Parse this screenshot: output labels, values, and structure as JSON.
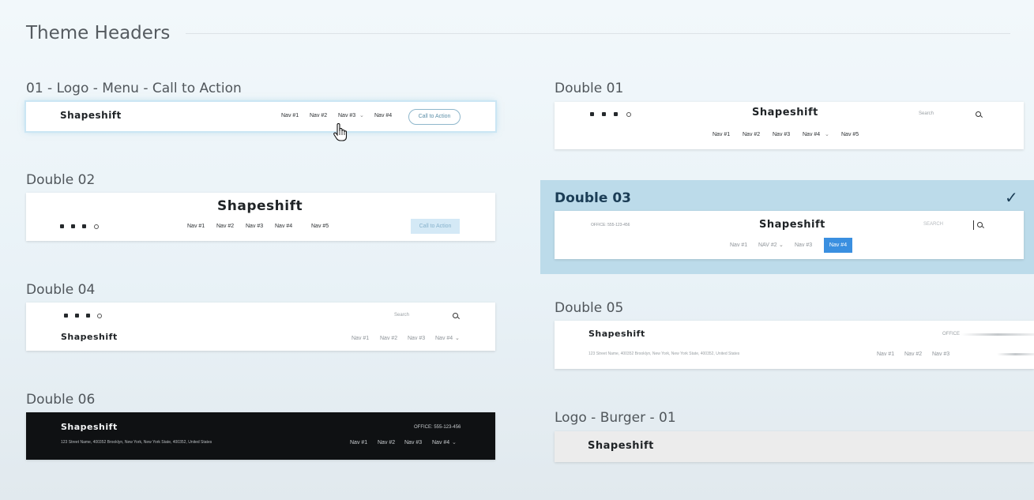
{
  "page": {
    "title": "Theme Headers"
  },
  "tiles": {
    "t01": {
      "title": "01 - Logo - Menu - Call to Action",
      "logo": "Shapeshift",
      "nav": [
        "Nav #1",
        "Nav #2",
        "Nav #3",
        "Nav #4"
      ],
      "cta": "Call to Action"
    },
    "d01": {
      "title": "Double 01",
      "logo": "Shapeshift",
      "search": "Search",
      "nav": [
        "Nav #1",
        "Nav #2",
        "Nav #3",
        "Nav #4",
        "Nav #5"
      ]
    },
    "d02": {
      "title": "Double 02",
      "logo": "Shapeshift",
      "nav": [
        "Nav #1",
        "Nav #2",
        "Nav #3",
        "Nav #4",
        "Nav #5"
      ],
      "cta": "Call to Action"
    },
    "d03": {
      "title": "Double 03",
      "office": "OFFICE: 555-123-456",
      "logo": "Shapeshift",
      "search": "SEARCH",
      "nav": [
        "Nav #1",
        "NAV #2",
        "Nav #3",
        "Nav #4"
      ],
      "selected": true
    },
    "d04": {
      "title": "Double 04",
      "search": "Search",
      "logo": "Shapeshift",
      "nav": [
        "Nav #1",
        "Nav #2",
        "Nav #3",
        "Nav #4"
      ]
    },
    "d05": {
      "title": "Double 05",
      "logo": "Shapeshift",
      "office": "OFFICE",
      "address": "123 Street Name, 400352 Brooklyn, New York, New York State, 400352, United States",
      "nav": [
        "Nav #1",
        "Nav #2",
        "Nav #3"
      ]
    },
    "d06": {
      "title": "Double 06",
      "logo": "Shapeshift",
      "office": "OFFICE: 555-123-456",
      "address": "123 Street Name, 400352 Brooklyn, New York, New York State, 400352, United States",
      "nav": [
        "Nav #1",
        "Nav #2",
        "Nav #3",
        "Nav #4"
      ]
    },
    "lb01": {
      "title": "Logo - Burger - 01",
      "logo": "Shapeshift"
    }
  },
  "icons": {
    "check": "check-icon",
    "cursor": "hand-pointer-icon",
    "search": "search-icon"
  },
  "colors": {
    "selected_bg": "#bcdbea",
    "nav_pill": "#3a8fe0",
    "dark_card": "#0f1113"
  }
}
